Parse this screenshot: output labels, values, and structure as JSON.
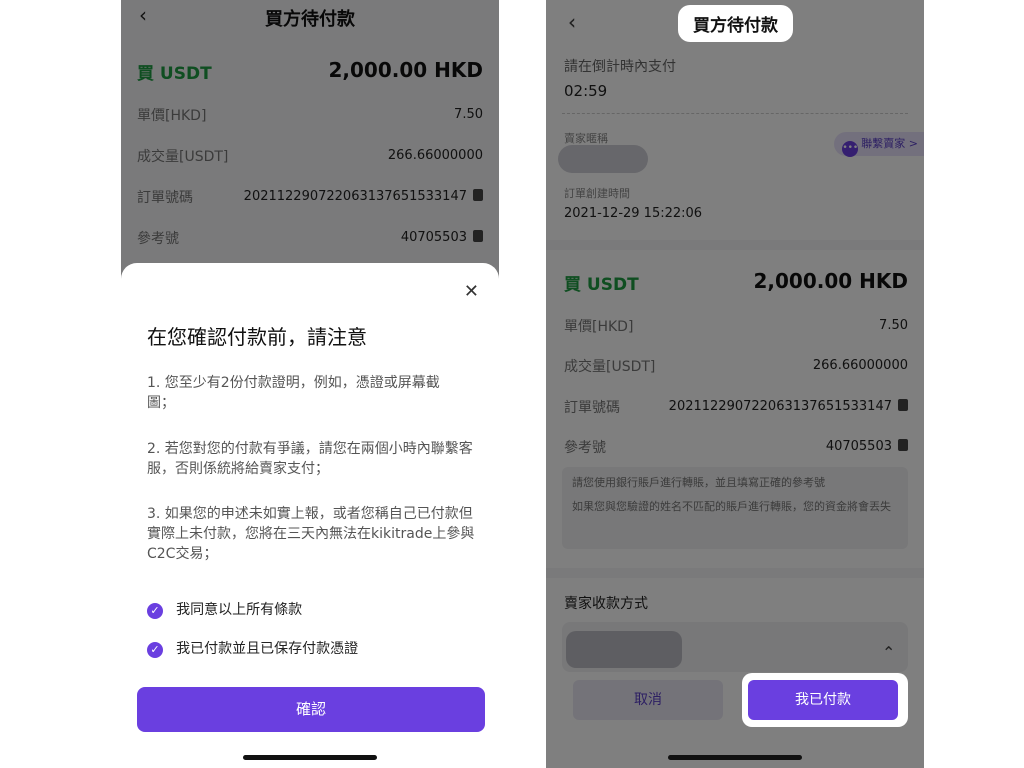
{
  "left": {
    "header": {
      "back_icon": "‹",
      "title": "買方待付款"
    },
    "order": {
      "side_label": "買 USDT",
      "amount": "2,000.00 HKD",
      "rows": [
        {
          "label": "單價[HKD]",
          "value": "7.50"
        },
        {
          "label": "成交量[USDT]",
          "value": "266.66000000"
        },
        {
          "label": "訂單號碼",
          "value": "20211229072206313765153314​7"
        },
        {
          "label": "參考號",
          "value": "40705503"
        }
      ]
    },
    "modal": {
      "close_icon": "✕",
      "title": "在您確認付款前，請注意",
      "rules": [
        "1. 您至少有2份付款證明，例如，憑證或屏幕截圖；",
        "2. 若您對您的付款有爭議，請您在兩個小時內聯繫客服，否則係統將給賣家支付；",
        "3. 如果您的申述未如實上報，或者您稱自己已付款但實際上未付款，您將在三天內無法在kikitrade上參與C2C交易；"
      ],
      "checks": [
        {
          "label": "我同意以上所有條款",
          "checked": true
        },
        {
          "label": "我已付款並且已保存付款憑證",
          "checked": true
        }
      ],
      "confirm_label": "確認"
    }
  },
  "right": {
    "header": {
      "back_icon": "‹",
      "title": "買方待付款"
    },
    "countdown": {
      "label": "請在倒計時內支付",
      "value": "02:59"
    },
    "seller": {
      "nickname_label": "賣家暱稱",
      "contact_label": "聯繫賣家",
      "contact_icon": "•••",
      "contact_chevron": ">"
    },
    "created": {
      "label": "訂單創建時間",
      "value": "2021-12-29 15:22:06"
    },
    "order": {
      "side_label": "買 USDT",
      "amount": "2,000.00 HKD",
      "rows": [
        {
          "label": "單價[HKD]",
          "value": "7.50"
        },
        {
          "label": "成交量[USDT]",
          "value": "266.66000000"
        },
        {
          "label": "訂單號碼",
          "value": "202112290722063137651533147"
        },
        {
          "label": "參考號",
          "value": "40705503"
        }
      ]
    },
    "notice": [
      "請您使用銀行賬戶進行轉賬，並且填寫正確的參考號",
      "如果您與您驗證的姓名不匹配的賬戶進行轉賬，您的資金將會丟失"
    ],
    "payment": {
      "title": "賣家收款方式",
      "chevron": "⌃"
    },
    "buttons": {
      "cancel_label": "取消",
      "paid_label": "我已付款"
    }
  }
}
